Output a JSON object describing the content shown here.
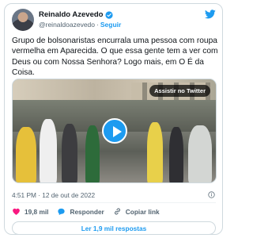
{
  "author": {
    "name": "Reinaldo Azevedo",
    "handle": "@reinaldoazevedo",
    "separator": "·",
    "follow_label": "Seguir"
  },
  "tweet": {
    "text": "Grupo de bolsonaristas encurrala uma pessoa com roupa vermelha em Aparecida. O que essa gente tem a ver com Deus ou com Nossa Senhora? Logo mais, em O É da Coisa."
  },
  "media": {
    "watch_label": "Assistir no Twitter"
  },
  "meta": {
    "timestamp": "4:51 PM · 12 de out de 2022"
  },
  "actions": {
    "likes": "19,8 mil",
    "reply_label": "Responder",
    "copy_link_label": "Copiar link"
  },
  "replies_button": "Ler 1,9 mil respostas",
  "colors": {
    "accent": "#1d9bf0",
    "like": "#f91880",
    "text_secondary": "#536471"
  }
}
